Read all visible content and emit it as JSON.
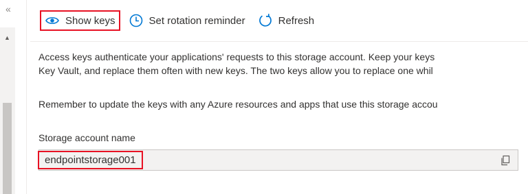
{
  "nav": {
    "collapse_glyph": "«"
  },
  "toolbar": {
    "show_keys": {
      "label": "Show keys",
      "icon": "eye-icon"
    },
    "rotation": {
      "label": "Set rotation reminder",
      "icon": "clock-icon"
    },
    "refresh": {
      "label": "Refresh",
      "icon": "refresh-icon"
    }
  },
  "content": {
    "description_line1": "Access keys authenticate your applications' requests to this storage account. Keep your keys",
    "description_line2": "Key Vault, and replace them often with new keys. The two keys allow you to replace one whil",
    "reminder": "Remember to update the keys with any Azure resources and apps that use this storage accou",
    "storage_account": {
      "label": "Storage account name",
      "value": "endpointstorage001",
      "copy_icon": "copy-icon"
    }
  },
  "colors": {
    "accent": "#0078d4",
    "highlight": "#e81123",
    "field_bg": "#f3f2f1"
  }
}
